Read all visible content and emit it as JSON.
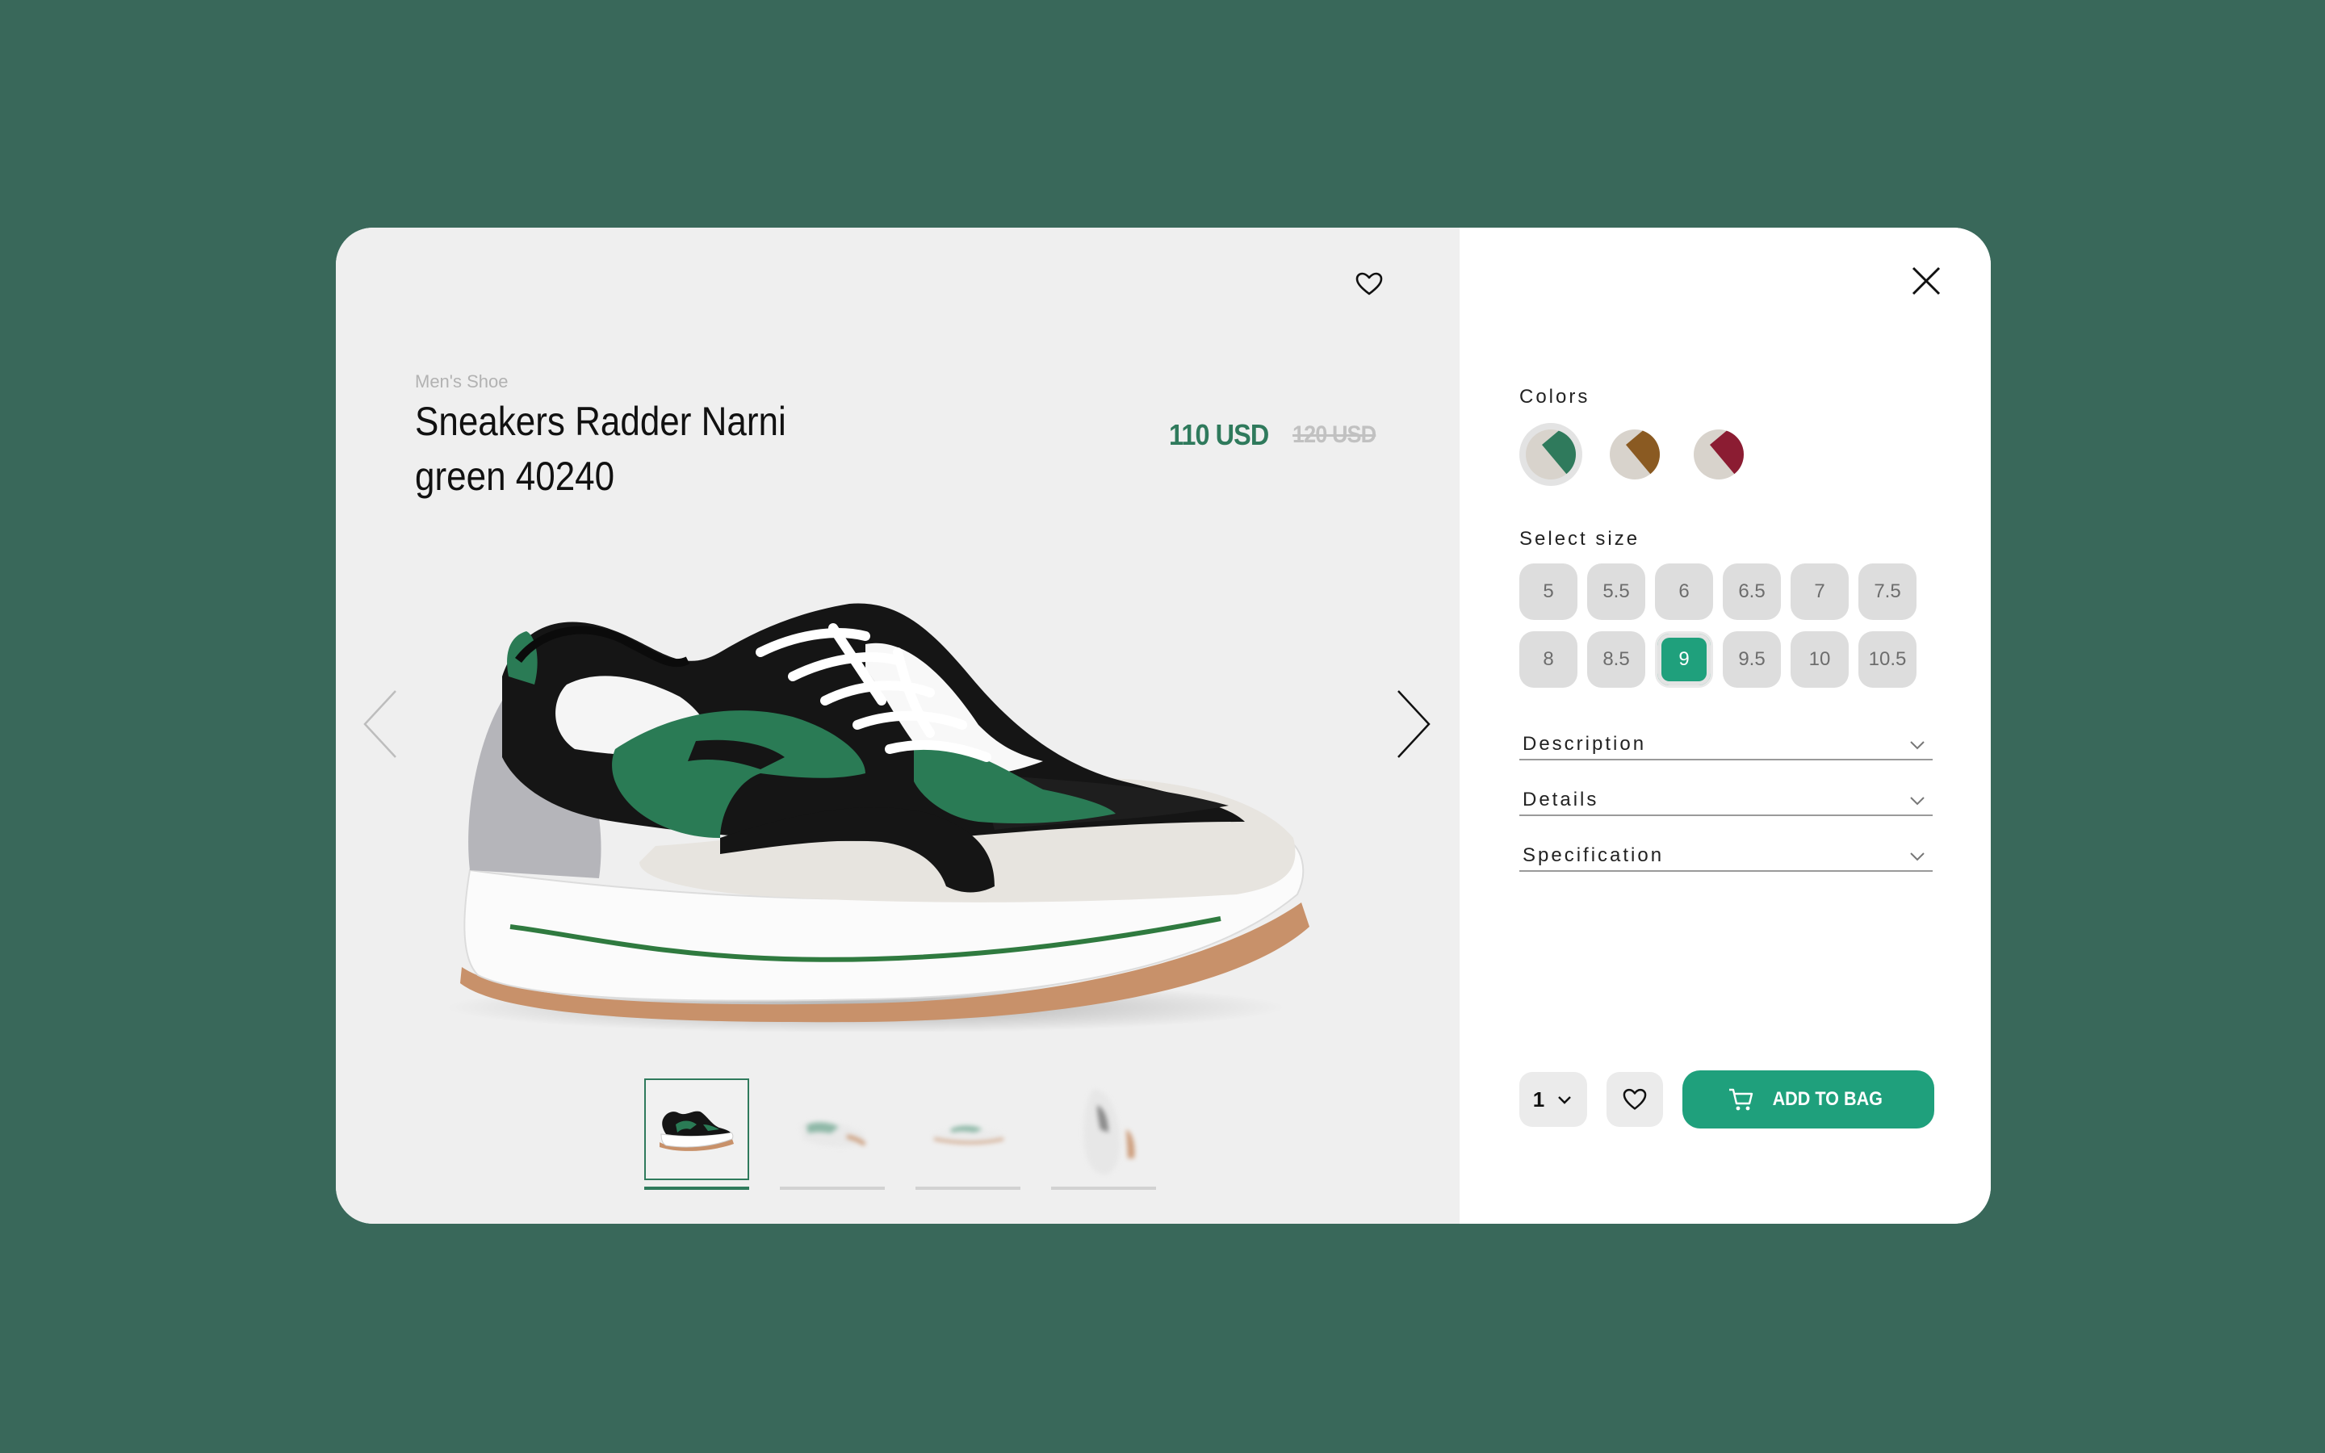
{
  "product": {
    "category": "Men's Shoe",
    "title": "Sneakers Radder Narni green 40240",
    "price": "110 USD",
    "old_price": "120 USD"
  },
  "colors": {
    "label": "Colors",
    "options": [
      {
        "name": "green",
        "accent": "#2f7a5c",
        "selected": true
      },
      {
        "name": "brown",
        "accent": "#8a5a22",
        "selected": false
      },
      {
        "name": "burgundy",
        "accent": "#8b1c32",
        "selected": false
      }
    ]
  },
  "sizes": {
    "label": "Select size",
    "options": [
      "5",
      "5.5",
      "6",
      "6.5",
      "7",
      "7.5",
      "8",
      "8.5",
      "9",
      "9.5",
      "10",
      "10.5"
    ],
    "selected": "9"
  },
  "accordions": {
    "description": "Description",
    "details": "Details",
    "specification": "Specification"
  },
  "cart": {
    "quantity": "1",
    "add_label": "ADD TO BAG"
  },
  "icons": {
    "favorite": "heart-icon",
    "close": "close-icon",
    "prev": "chevron-left-icon",
    "next": "chevron-right-icon",
    "cart": "cart-icon",
    "dropdown": "chevron-down-icon"
  },
  "theme": {
    "background": "#39685a",
    "accent": "#1fa07c",
    "price": "#2f7a5c"
  },
  "gallery": {
    "thumbnail_count": 4,
    "active_index": 0
  }
}
